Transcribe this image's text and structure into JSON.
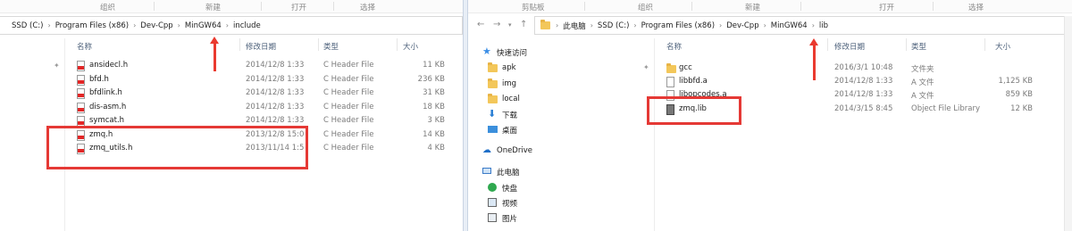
{
  "left": {
    "ribbon": [
      "组织",
      "新建",
      "打开",
      "选择"
    ],
    "breadcrumb": [
      "SSD (C:)",
      "Program Files (x86)",
      "Dev-Cpp",
      "MinGW64",
      "include"
    ],
    "columns": {
      "name": "名称",
      "date": "修改日期",
      "type": "类型",
      "size": "大小"
    },
    "files": [
      {
        "name": "ansidecl.h",
        "date": "2014/12/8 1:33",
        "type": "C Header File",
        "size": "11 KB"
      },
      {
        "name": "bfd.h",
        "date": "2014/12/8 1:33",
        "type": "C Header File",
        "size": "236 KB"
      },
      {
        "name": "bfdlink.h",
        "date": "2014/12/8 1:33",
        "type": "C Header File",
        "size": "31 KB"
      },
      {
        "name": "dis-asm.h",
        "date": "2014/12/8 1:33",
        "type": "C Header File",
        "size": "18 KB"
      },
      {
        "name": "symcat.h",
        "date": "2014/12/8 1:33",
        "type": "C Header File",
        "size": "3 KB"
      },
      {
        "name": "zmq.h",
        "date": "2013/12/8 15:0",
        "type": "C Header File",
        "size": "14 KB"
      },
      {
        "name": "zmq_utils.h",
        "date": "2013/11/14 1:5",
        "type": "C Header File",
        "size": "4 KB"
      }
    ]
  },
  "right": {
    "ribbon": [
      "剪贴板",
      "组织",
      "新建",
      "打开",
      "选择"
    ],
    "breadcrumb": [
      "此电脑",
      "SSD (C:)",
      "Program Files (x86)",
      "Dev-Cpp",
      "MinGW64",
      "lib"
    ],
    "columns": {
      "name": "名称",
      "date": "修改日期",
      "type": "类型",
      "size": "大小"
    },
    "nav": {
      "quick_access": "快速访问",
      "pinned": [
        "apk",
        "img",
        "local",
        "下载",
        "桌面"
      ],
      "onedrive": "OneDrive",
      "this_pc": "此电脑",
      "pc_items": [
        "快盘",
        "视频",
        "图片"
      ]
    },
    "files": [
      {
        "name": "gcc",
        "date": "2016/3/1 10:48",
        "type": "文件夹",
        "size": ""
      },
      {
        "name": "libbfd.a",
        "date": "2014/12/8 1:33",
        "type": "A 文件",
        "size": "1,125 KB"
      },
      {
        "name": "libopcodes.a",
        "date": "2014/12/8 1:33",
        "type": "A 文件",
        "size": "859 KB"
      },
      {
        "name": "zmq.lib",
        "date": "2014/3/15 8:45",
        "type": "Object File Library",
        "size": "12 KB"
      }
    ]
  },
  "colors": {
    "highlight": "#e53935",
    "arrow": "#ea3a2f",
    "header_text": "#4c607a"
  }
}
